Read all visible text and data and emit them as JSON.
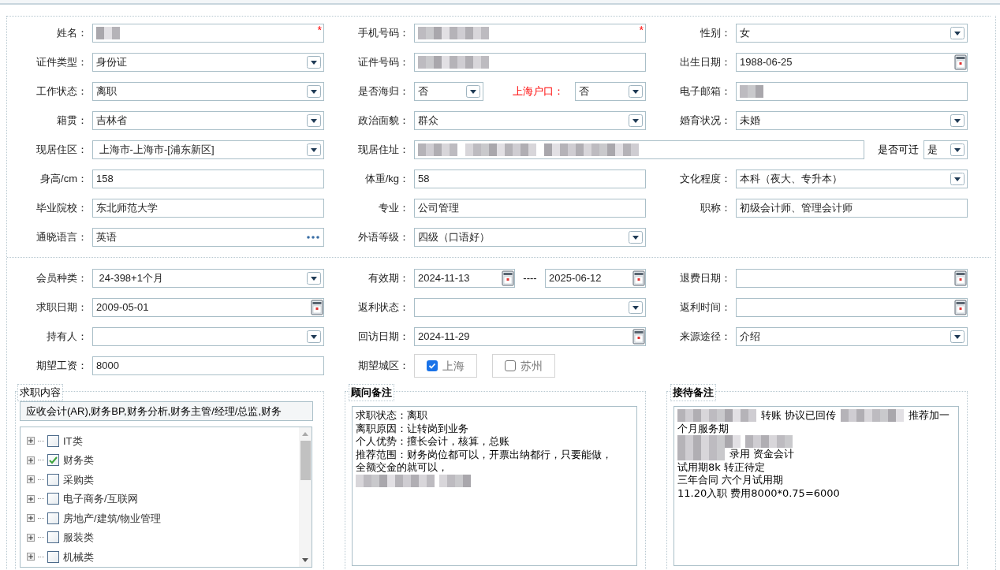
{
  "form": {
    "sections": [
      {
        "rows": [
          [
            {
              "label": "姓名：",
              "kind": "blurred",
              "required_mark": "*"
            },
            {
              "label": "手机号码：",
              "kind": "blurred",
              "required_mark": "*"
            },
            {
              "label": "性别：",
              "kind": "select",
              "value": "女"
            }
          ],
          [
            {
              "label": "证件类型：",
              "kind": "select",
              "value": "身份证"
            },
            {
              "label": "证件号码：",
              "kind": "blurred"
            },
            {
              "label": "出生日期：",
              "kind": "date",
              "value": "1988-06-25"
            }
          ],
          [
            {
              "label": "工作状态：",
              "kind": "select",
              "value": "离职"
            },
            {
              "label": "是否海归：",
              "kind": "pair",
              "value": "否",
              "second_label": "上海户口：",
              "second_label_highlighted": true,
              "second_value": "否"
            },
            {
              "label": "电子邮箱：",
              "kind": "blurred"
            }
          ],
          [
            {
              "label": "籍贯：",
              "kind": "select",
              "value": "吉林省"
            },
            {
              "label": "政治面貌：",
              "kind": "select",
              "value": "群众"
            },
            {
              "label": "婚育状况：",
              "kind": "select",
              "value": "未婚"
            }
          ],
          [
            {
              "label": "现居住区：",
              "kind": "select",
              "value": " 上海市-上海市-[浦东新区]"
            },
            {
              "label": "现居住址：",
              "kind": "address",
              "second_label": "是否可迁",
              "second_value": "是"
            }
          ],
          [
            {
              "label": "身高/cm：",
              "kind": "text",
              "value": "158"
            },
            {
              "label": "体重/kg：",
              "kind": "text",
              "value": "58"
            },
            {
              "label": "文化程度：",
              "kind": "select",
              "value": "本科（夜大、专升本）"
            }
          ],
          [
            {
              "label": "毕业院校：",
              "kind": "text",
              "value": "东北师范大学"
            },
            {
              "label": "专业：",
              "kind": "text",
              "value": "公司管理"
            },
            {
              "label": "职称：",
              "kind": "text",
              "value": "初级会计师、管理会计师"
            }
          ],
          [
            {
              "label": "通晓语言：",
              "kind": "lookup",
              "value": "英语"
            },
            {
              "label": "外语等级：",
              "kind": "select",
              "value": "四级（口语好）"
            }
          ]
        ]
      },
      {
        "rows": [
          [
            {
              "label": "会员种类：",
              "kind": "select",
              "value": " 24-398+1个月"
            },
            {
              "label": "有效期：",
              "kind": "daterange",
              "value": "2024-11-13",
              "separator": "----",
              "second_value": "2025-06-12"
            },
            {
              "label": "退费日期：",
              "kind": "date"
            }
          ],
          [
            {
              "label": "求职日期：",
              "kind": "date",
              "value": "2009-05-01"
            },
            {
              "label": "返利状态：",
              "kind": "select"
            },
            {
              "label": "返利时间：",
              "kind": "date"
            }
          ],
          [
            {
              "label": "持有人：",
              "kind": "select"
            },
            {
              "label": "回访日期：",
              "kind": "date",
              "value": "2024-11-29"
            },
            {
              "label": "来源途径：",
              "kind": "select",
              "value": "介绍"
            }
          ],
          [
            {
              "label": "期望工资：",
              "kind": "text",
              "value": "8000"
            },
            {
              "label": "期望城区：",
              "kind": "checkboxes",
              "options": [
                {
                  "label": "上海",
                  "checked": true
                },
                {
                  "label": "苏州",
                  "checked": false
                }
              ]
            }
          ]
        ]
      }
    ]
  },
  "job_content": {
    "title": "求职内容",
    "summary": "应收会计(AR),财务BP,财务分析,财务主管/经理/总监,财务",
    "tree": [
      {
        "label": "IT类",
        "checked": false,
        "expanded": false
      },
      {
        "label": "财务类",
        "checked": true,
        "expanded": false
      },
      {
        "label": "采购类",
        "checked": false,
        "expanded": false
      },
      {
        "label": "电子商务/互联网",
        "checked": false,
        "expanded": false
      },
      {
        "label": "房地产/建筑/物业管理",
        "checked": false,
        "expanded": false
      },
      {
        "label": "服装类",
        "checked": false,
        "expanded": false
      },
      {
        "label": "机械类",
        "checked": false,
        "expanded": false
      }
    ]
  },
  "notes": [
    {
      "title": "顾问备注",
      "lines": [
        [
          {
            "kind": "text",
            "text": "求职状态：离职"
          }
        ],
        [
          {
            "kind": "text",
            "text": "离职原因：让转岗到业务"
          }
        ],
        [
          {
            "kind": "text",
            "text": "个人优势：擅长会计，核算，总账"
          }
        ],
        [
          {
            "kind": "text",
            "text": "推荐范围：财务岗位都可以，开票出纳都行，只要能做，"
          }
        ],
        [
          {
            "kind": "text",
            "text": "全额交金的就可以，"
          }
        ],
        [
          {
            "kind": "blur"
          },
          {
            "kind": "blur"
          }
        ]
      ]
    },
    {
      "title": "接待备注",
      "lines": [
        [
          {
            "kind": "blur"
          },
          {
            "kind": "text",
            "text": "转账 协议已回传"
          },
          {
            "kind": "blur"
          },
          {
            "kind": "text",
            "text": "推荐加一"
          }
        ],
        [
          {
            "kind": "text",
            "text": "个月服务期"
          }
        ],
        [
          {
            "kind": "blur"
          },
          {
            "kind": "blur"
          }
        ],
        [
          {
            "kind": "blur"
          },
          {
            "kind": "text",
            "text": "录用 资金会计"
          }
        ],
        [
          {
            "kind": "text",
            "text": "试用期8k 转正待定"
          }
        ],
        [
          {
            "kind": "text",
            "text": "三年合同 六个月试用期"
          }
        ],
        [
          {
            "kind": "text",
            "text": "11.20入职 费用8000*0.75=6000"
          }
        ]
      ]
    }
  ]
}
